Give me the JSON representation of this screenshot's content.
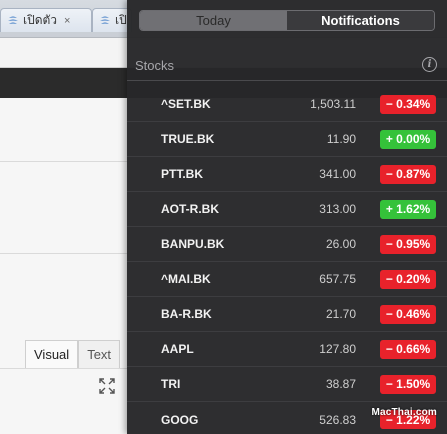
{
  "browser": {
    "tabs": [
      {
        "label": "เปิดตัว",
        "close": "×"
      },
      {
        "label": "เปิ",
        "close": "×"
      }
    ],
    "editor_tabs": [
      {
        "label": "Visual"
      },
      {
        "label": "Text"
      }
    ]
  },
  "notification_center": {
    "segments": {
      "today": "Today",
      "notifications": "Notifications"
    },
    "section_title": "Stocks",
    "info_label": "i",
    "stocks": [
      {
        "symbol": "^SET.BK",
        "price": "1,503.11",
        "change": "− 0.34%",
        "direction": "down"
      },
      {
        "symbol": "TRUE.BK",
        "price": "11.90",
        "change": "+ 0.00%",
        "direction": "up"
      },
      {
        "symbol": "PTT.BK",
        "price": "341.00",
        "change": "− 0.87%",
        "direction": "down"
      },
      {
        "symbol": "AOT-R.BK",
        "price": "313.00",
        "change": "+ 1.62%",
        "direction": "up"
      },
      {
        "symbol": "BANPU.BK",
        "price": "26.00",
        "change": "− 0.95%",
        "direction": "down"
      },
      {
        "symbol": "^MAI.BK",
        "price": "657.75",
        "change": "− 0.20%",
        "direction": "down"
      },
      {
        "symbol": "BA-R.BK",
        "price": "21.70",
        "change": "− 0.46%",
        "direction": "down"
      },
      {
        "symbol": "AAPL",
        "price": "127.80",
        "change": "− 0.66%",
        "direction": "down"
      },
      {
        "symbol": "TRI",
        "price": "38.87",
        "change": "− 1.50%",
        "direction": "down"
      },
      {
        "symbol": "GOOG",
        "price": "526.83",
        "change": "− 1.22%",
        "direction": "down"
      }
    ],
    "colors": {
      "down": "#e8222b",
      "up": "#35c23a",
      "panel_bg": "#272729"
    }
  },
  "watermark": "MacThai.com"
}
